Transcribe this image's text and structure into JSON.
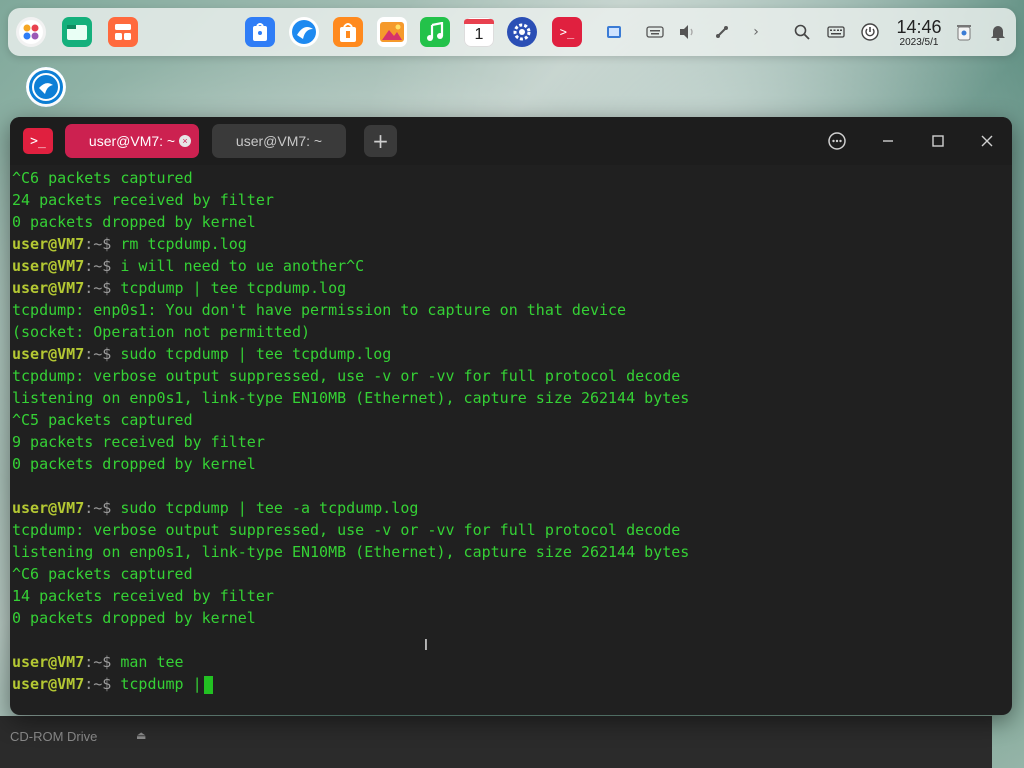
{
  "dock": {
    "apps": [
      {
        "name": "launcher-icon",
        "color": "#f0f0f0"
      },
      {
        "name": "file-manager-icon",
        "color": "#14b07c"
      },
      {
        "name": "multitask-view-icon",
        "color": "#ff6a3d"
      },
      {
        "name": "app-store-icon",
        "color": "#2f7df6"
      },
      {
        "name": "browser-icon",
        "color": "#1e8af0"
      },
      {
        "name": "app-market-icon",
        "color": "#ff8a1e"
      },
      {
        "name": "photos-icon",
        "color": "#f59a2c"
      },
      {
        "name": "music-icon",
        "color": "#23c24a"
      },
      {
        "name": "calendar-icon",
        "color": "#ffffff"
      },
      {
        "name": "settings-icon",
        "color": "#2b4fb5"
      },
      {
        "name": "terminal-icon",
        "color": "#e0203f"
      }
    ],
    "calendar_day": "1",
    "clock_time": "14:46",
    "clock_date": "2023/5/1"
  },
  "window": {
    "tabs": [
      {
        "label": "user@VM7: ~",
        "active": true
      },
      {
        "label": "user@VM7: ~",
        "active": false
      }
    ],
    "add_tab": "+"
  },
  "terminal": {
    "lines": [
      {
        "text": "^C6 packets captured"
      },
      {
        "text": "24 packets received by filter"
      },
      {
        "text": "0 packets dropped by kernel"
      },
      {
        "user": "user@VM7",
        "path": ":~$",
        "cmd": " rm tcpdump.log"
      },
      {
        "user": "user@VM7",
        "path": ":~$",
        "cmd": " i will need to ue another^C"
      },
      {
        "user": "user@VM7",
        "path": ":~$",
        "cmd": " tcpdump | tee tcpdump.log"
      },
      {
        "text": "tcpdump: enp0s1: You don't have permission to capture on that device"
      },
      {
        "text": "(socket: Operation not permitted)"
      },
      {
        "user": "user@VM7",
        "path": ":~$",
        "cmd": " sudo tcpdump | tee tcpdump.log"
      },
      {
        "text": "tcpdump: verbose output suppressed, use -v or -vv for full protocol decode"
      },
      {
        "text": "listening on enp0s1, link-type EN10MB (Ethernet), capture size 262144 bytes"
      },
      {
        "text": "^C5 packets captured"
      },
      {
        "text": "9 packets received by filter"
      },
      {
        "text": "0 packets dropped by kernel"
      },
      {
        "text": ""
      },
      {
        "user": "user@VM7",
        "path": ":~$",
        "cmd": " sudo tcpdump | tee -a tcpdump.log"
      },
      {
        "text": "tcpdump: verbose output suppressed, use -v or -vv for full protocol decode"
      },
      {
        "text": "listening on enp0s1, link-type EN10MB (Ethernet), capture size 262144 bytes"
      },
      {
        "text": "^C6 packets captured"
      },
      {
        "text": "14 packets received by filter"
      },
      {
        "text": "0 packets dropped by kernel"
      },
      {
        "text": ""
      },
      {
        "user": "user@VM7",
        "path": ":~$",
        "cmd": " man tee"
      },
      {
        "user": "user@VM7",
        "path": ":~$",
        "cmd": " tcpdump |",
        "cursor": true
      }
    ]
  },
  "background": {
    "cdrom_label": "CD-ROM Drive",
    "eject_glyph": "⏏"
  },
  "colors": {
    "output": "#35d135",
    "prompt": "#b4c833",
    "accent": "#cc2150"
  }
}
